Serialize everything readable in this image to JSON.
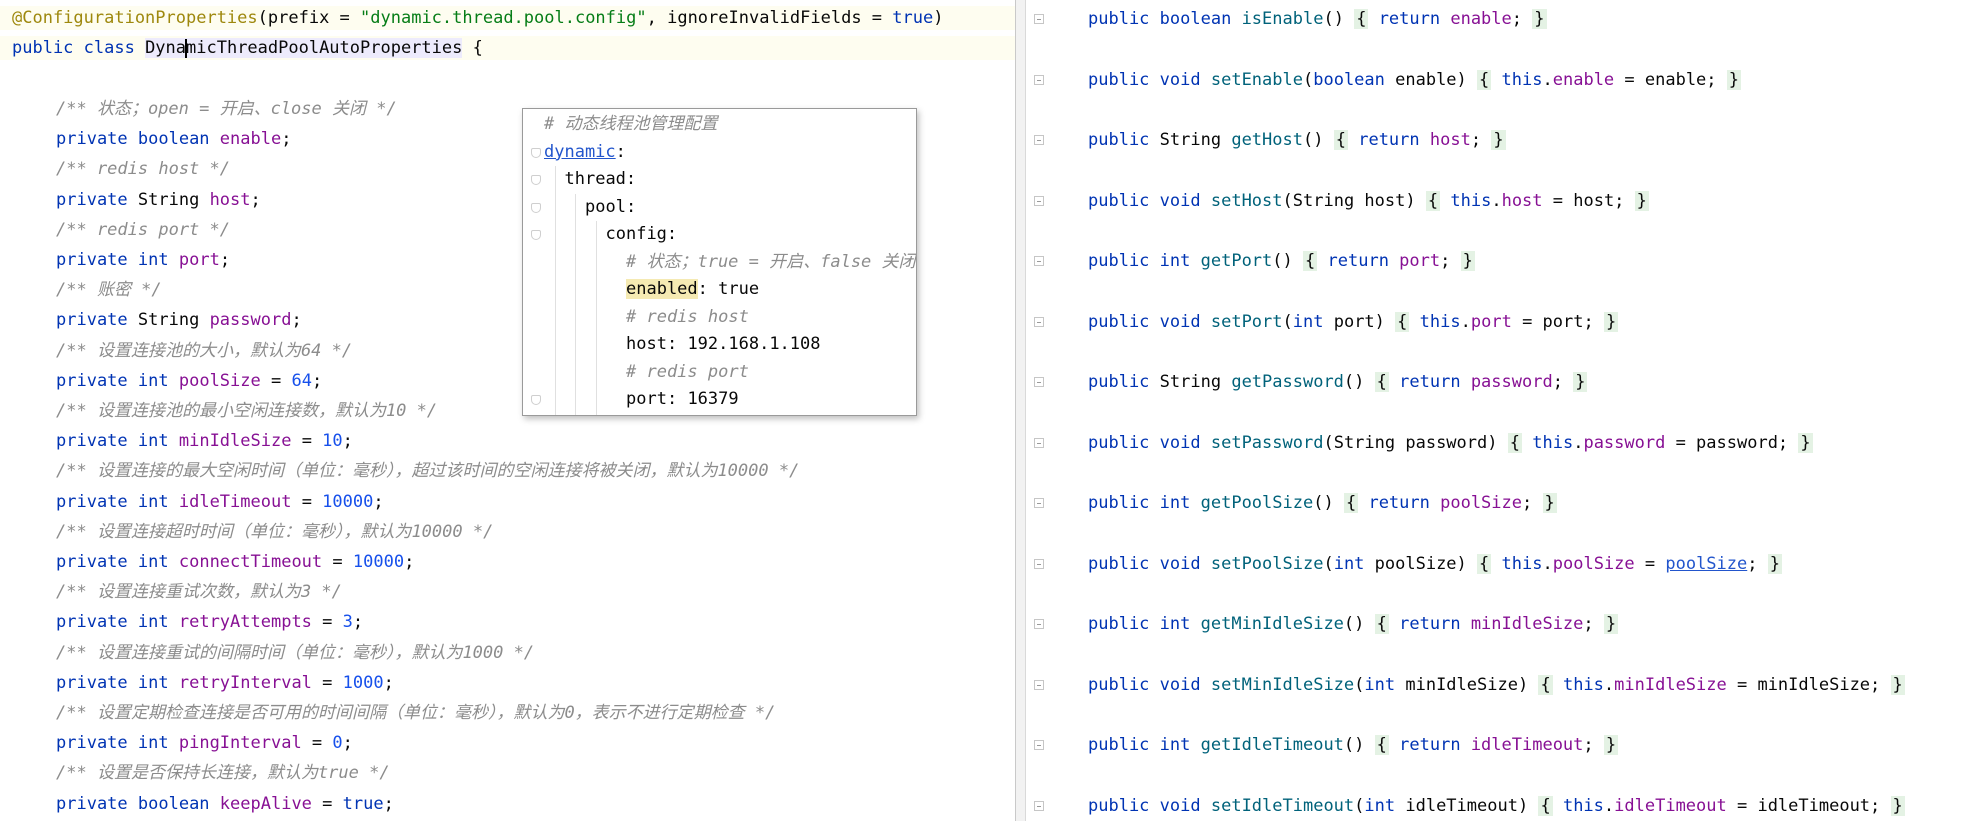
{
  "left_editor": {
    "lines": [
      {
        "annotation": "@ConfigurationProperties",
        "open": "(",
        "prefix_key": "prefix",
        "eq": " = ",
        "prefix_value": "\"dynamic.thread.pool.config\"",
        "comma": ", ",
        "ignore_key": "ignoreInvalidFields",
        "eq2": " = ",
        "ignore_value": "true",
        "close": ")"
      },
      {
        "kw": "public class ",
        "name_part1": "Dyna",
        "name_part2": "micThreadPoolAutoProperties",
        "brace": " {"
      }
    ],
    "fields": [
      {
        "comment": "/** 状态；open = 开启、close 关闭 */",
        "modifier": "private ",
        "type": "boolean",
        "type_is_kw": true,
        "name": "enable",
        "value": "",
        "semi": ";"
      },
      {
        "comment": "/** redis host */",
        "modifier": "private ",
        "type": "String",
        "type_is_kw": false,
        "name": "host",
        "value": "",
        "semi": ";"
      },
      {
        "comment": "/** redis port */",
        "modifier": "private ",
        "type": "int",
        "type_is_kw": true,
        "name": "port",
        "value": "",
        "semi": ";"
      },
      {
        "comment": "/** 账密 */",
        "modifier": "private ",
        "type": "String",
        "type_is_kw": false,
        "name": "password",
        "value": "",
        "semi": ";"
      },
      {
        "comment": "/** 设置连接池的大小，默认为64 */",
        "modifier": "private ",
        "type": "int",
        "type_is_kw": true,
        "name": "poolSize",
        "value": "64",
        "semi": ";"
      },
      {
        "comment": "/** 设置连接池的最小空闲连接数，默认为10 */",
        "modifier": "private ",
        "type": "int",
        "type_is_kw": true,
        "name": "minIdleSize",
        "value": "10",
        "semi": ";"
      },
      {
        "comment": "/** 设置连接的最大空闲时间（单位：毫秒），超过该时间的空闲连接将被关闭，默认为10000 */",
        "modifier": "private ",
        "type": "int",
        "type_is_kw": true,
        "name": "idleTimeout",
        "value": "10000",
        "semi": ";"
      },
      {
        "comment": "/** 设置连接超时时间（单位：毫秒），默认为10000 */",
        "modifier": "private ",
        "type": "int",
        "type_is_kw": true,
        "name": "connectTimeout",
        "value": "10000",
        "semi": ";"
      },
      {
        "comment": "/** 设置连接重试次数，默认为3 */",
        "modifier": "private ",
        "type": "int",
        "type_is_kw": true,
        "name": "retryAttempts",
        "value": "3",
        "semi": ";"
      },
      {
        "comment": "/** 设置连接重试的间隔时间（单位：毫秒），默认为1000 */",
        "modifier": "private ",
        "type": "int",
        "type_is_kw": true,
        "name": "retryInterval",
        "value": "1000",
        "semi": ";"
      },
      {
        "comment": "/** 设置定期检查连接是否可用的时间间隔（单位：毫秒），默认为0，表示不进行定期检查 */",
        "modifier": "private ",
        "type": "int",
        "type_is_kw": true,
        "name": "pingInterval",
        "value": "0",
        "semi": ";"
      },
      {
        "comment": "/** 设置是否保持长连接，默认为true */",
        "modifier": "private ",
        "type": "boolean",
        "type_is_kw": true,
        "name": "keepAlive",
        "value": "true",
        "semi": ";"
      }
    ]
  },
  "yaml_popup": {
    "lines": [
      {
        "type": "comment",
        "text": "# 动态线程池管理配置",
        "indent": 0
      },
      {
        "type": "key",
        "key": "dynamic",
        "link": true,
        "suffix": ":",
        "indent": 0
      },
      {
        "type": "key",
        "key": "thread",
        "suffix": ":",
        "indent": 1
      },
      {
        "type": "key",
        "key": "pool",
        "suffix": ":",
        "indent": 2
      },
      {
        "type": "key",
        "key": "config",
        "suffix": ":",
        "indent": 3
      },
      {
        "type": "comment",
        "text": "# 状态；true = 开启、false 关闭",
        "indent": 4
      },
      {
        "type": "kv",
        "key": "enabled",
        "highlight": true,
        "sep": ": ",
        "value": "true",
        "indent": 4
      },
      {
        "type": "comment",
        "text": "# redis host",
        "indent": 4
      },
      {
        "type": "kv",
        "key": "host",
        "sep": ": ",
        "value": "192.168.1.108",
        "indent": 4
      },
      {
        "type": "comment",
        "text": "# redis port",
        "indent": 4
      },
      {
        "type": "kv",
        "key": "port",
        "sep": ": ",
        "value": "16379",
        "indent": 4
      }
    ]
  },
  "right_editor": {
    "methods": [
      {
        "p1": "public ",
        "rtype": "boolean",
        "rtype_kw": true,
        "name": "isEnable",
        "params": "()",
        "body": [
          [
            "kw",
            "return "
          ],
          [
            "fld",
            "enable"
          ],
          [
            "t",
            ";"
          ]
        ]
      },
      {
        "p1": "public ",
        "rtype": "void",
        "rtype_kw": true,
        "name": "setEnable",
        "params": "(boolean enable)",
        "body": [
          [
            "kw",
            "this"
          ],
          [
            "t",
            "."
          ],
          [
            "fld",
            "enable"
          ],
          [
            "t",
            " = enable;"
          ]
        ]
      },
      {
        "p1": "public ",
        "rtype": "String",
        "rtype_kw": false,
        "name": "getHost",
        "params": "()",
        "body": [
          [
            "kw",
            "return "
          ],
          [
            "fld",
            "host"
          ],
          [
            "t",
            ";"
          ]
        ]
      },
      {
        "p1": "public ",
        "rtype": "void",
        "rtype_kw": true,
        "name": "setHost",
        "params": "(String host)",
        "body": [
          [
            "kw",
            "this"
          ],
          [
            "t",
            "."
          ],
          [
            "fld",
            "host"
          ],
          [
            "t",
            " = host;"
          ]
        ]
      },
      {
        "p1": "public ",
        "rtype": "int",
        "rtype_kw": true,
        "name": "getPort",
        "params": "()",
        "body": [
          [
            "kw",
            "return "
          ],
          [
            "fld",
            "port"
          ],
          [
            "t",
            ";"
          ]
        ]
      },
      {
        "p1": "public ",
        "rtype": "void",
        "rtype_kw": true,
        "name": "setPort",
        "params": "(int port)",
        "body": [
          [
            "kw",
            "this"
          ],
          [
            "t",
            "."
          ],
          [
            "fld",
            "port"
          ],
          [
            "t",
            " = port;"
          ]
        ]
      },
      {
        "p1": "public ",
        "rtype": "String",
        "rtype_kw": false,
        "name": "getPassword",
        "params": "()",
        "body": [
          [
            "kw",
            "return "
          ],
          [
            "fld",
            "password"
          ],
          [
            "t",
            ";"
          ]
        ]
      },
      {
        "p1": "public ",
        "rtype": "void",
        "rtype_kw": true,
        "name": "setPassword",
        "params": "(String password)",
        "body": [
          [
            "kw",
            "this"
          ],
          [
            "t",
            "."
          ],
          [
            "fld",
            "password"
          ],
          [
            "t",
            " = password;"
          ]
        ]
      },
      {
        "p1": "public ",
        "rtype": "int",
        "rtype_kw": true,
        "name": "getPoolSize",
        "params": "()",
        "body": [
          [
            "kw",
            "return "
          ],
          [
            "fld",
            "poolSize"
          ],
          [
            "t",
            ";"
          ]
        ]
      },
      {
        "p1": "public ",
        "rtype": "void",
        "rtype_kw": true,
        "name": "setPoolSize",
        "params": "(int poolSize)",
        "body": [
          [
            "kw",
            "this"
          ],
          [
            "t",
            "."
          ],
          [
            "fld",
            "poolSize"
          ],
          [
            "t",
            " = "
          ],
          [
            "ul",
            "poolSize"
          ],
          [
            "t",
            ";"
          ]
        ]
      },
      {
        "p1": "public ",
        "rtype": "int",
        "rtype_kw": true,
        "name": "getMinIdleSize",
        "params": "()",
        "body": [
          [
            "kw",
            "return "
          ],
          [
            "fld",
            "minIdleSize"
          ],
          [
            "t",
            ";"
          ]
        ]
      },
      {
        "p1": "public ",
        "rtype": "void",
        "rtype_kw": true,
        "name": "setMinIdleSize",
        "params": "(int minIdleSize)",
        "body": [
          [
            "kw",
            "this"
          ],
          [
            "t",
            "."
          ],
          [
            "fld",
            "minIdleSize"
          ],
          [
            "t",
            " = minIdleSize;"
          ]
        ]
      },
      {
        "p1": "public ",
        "rtype": "int",
        "rtype_kw": true,
        "name": "getIdleTimeout",
        "params": "()",
        "body": [
          [
            "kw",
            "return "
          ],
          [
            "fld",
            "idleTimeout"
          ],
          [
            "t",
            ";"
          ]
        ]
      },
      {
        "p1": "public ",
        "rtype": "void",
        "rtype_kw": true,
        "name": "setIdleTimeout",
        "params": "(int idleTimeout)",
        "body": [
          [
            "kw",
            "this"
          ],
          [
            "t",
            "."
          ],
          [
            "fld",
            "idleTimeout"
          ],
          [
            "t",
            " = idleTimeout;"
          ]
        ]
      }
    ]
  }
}
